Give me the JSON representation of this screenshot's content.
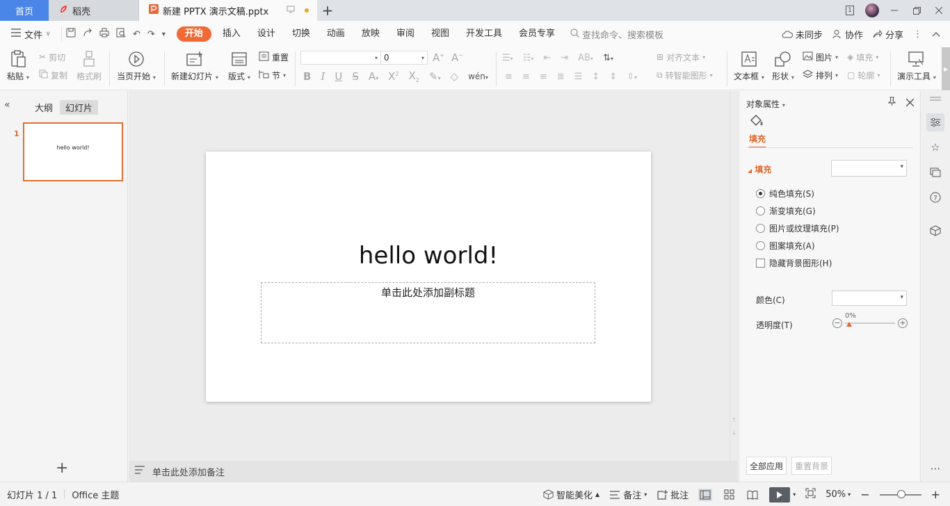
{
  "tabs": {
    "home": "首页",
    "docer": "稻壳",
    "active_doc": "新建 PPTX 演示文稿.pptx"
  },
  "menubar": {
    "file": "文件",
    "ribbon_tabs": [
      "开始",
      "插入",
      "设计",
      "切换",
      "动画",
      "放映",
      "审阅",
      "视图",
      "开发工具",
      "会员专享"
    ],
    "search_placeholder": "查找命令、搜索模板",
    "sync": "未同步",
    "collab": "协作",
    "share": "分享"
  },
  "ribbon": {
    "paste": "粘贴",
    "cut": "剪切",
    "copy": "复制",
    "format_painter": "格式刷",
    "from_current": "当页开始",
    "new_slide": "新建幻灯片",
    "layout": "版式",
    "reset": "重置",
    "section": "节",
    "font_name": "",
    "font_size": "0",
    "align_text": "对齐文本",
    "smart_art": "转智能图形",
    "textbox": "文本框",
    "shape": "形状",
    "picture": "图片",
    "fill": "填充",
    "arrange": "排列",
    "outline": "轮廓",
    "presentation_tools": "演示工具"
  },
  "left_panel": {
    "outline_tab": "大纲",
    "slides_tab": "幻灯片",
    "slide_number": "1",
    "thumb_text": "hello world!"
  },
  "slide": {
    "title": "hello world!",
    "subtitle_placeholder": "单击此处添加副标题"
  },
  "notes": {
    "placeholder": "单击此处添加备注"
  },
  "properties": {
    "header": "对象属性",
    "fill_tab": "填充",
    "fill_section": "填充",
    "options": [
      {
        "label": "纯色填充(S)",
        "checked": true
      },
      {
        "label": "渐变填充(G)",
        "checked": false
      },
      {
        "label": "图片或纹理填充(P)",
        "checked": false
      },
      {
        "label": "图案填充(A)",
        "checked": false
      }
    ],
    "hide_bg": "隐藏背景图形(H)",
    "color_label": "颜色(C)",
    "transparency_label": "透明度(T)",
    "transparency_value": "0%",
    "apply_all": "全部应用",
    "reset_bg": "重置背景"
  },
  "status": {
    "slide_info": "幻灯片 1 / 1",
    "theme": "Office 主题",
    "beautify": "智能美化",
    "notes": "备注",
    "comments": "批注",
    "zoom": "50%"
  },
  "colors": {
    "accent": "#f06a35",
    "home_tab": "#4a86e8"
  }
}
